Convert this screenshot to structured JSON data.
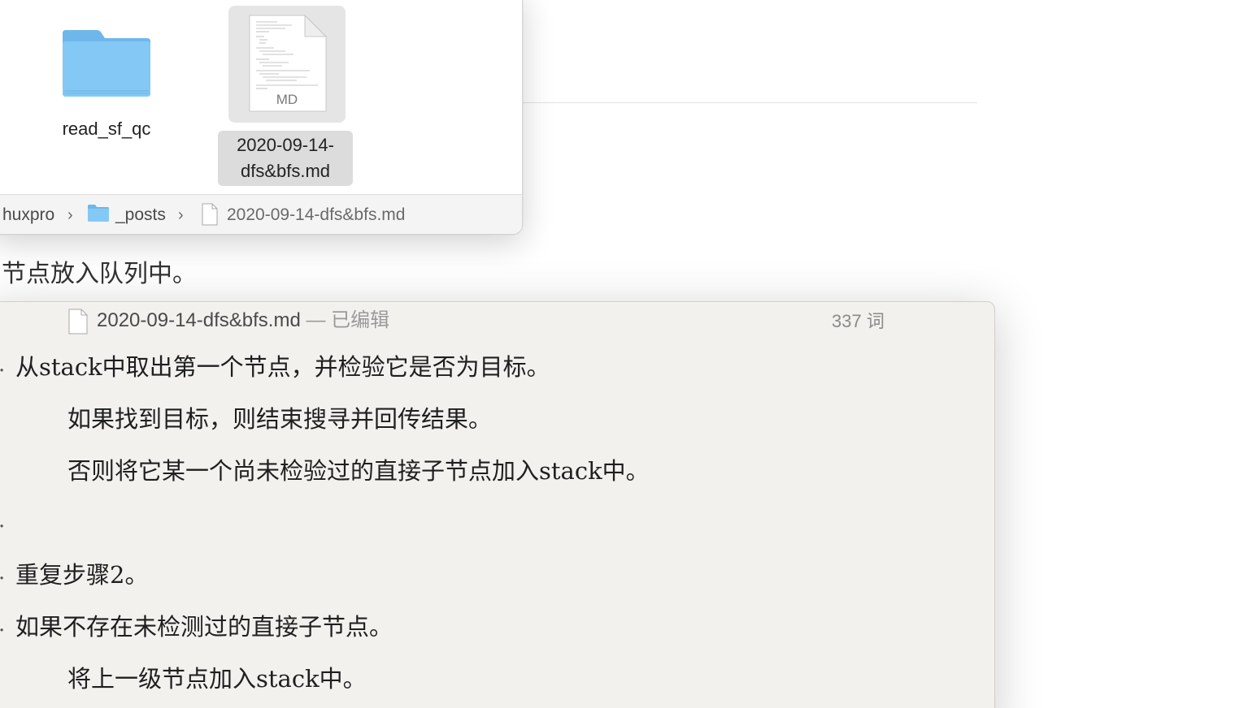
{
  "background_doc": {
    "text": "节点放入队列中。"
  },
  "finder": {
    "items": [
      {
        "name": "read_sf_qc",
        "kind": "folder"
      },
      {
        "name": "2020-09-14-dfs&bfs.md",
        "label_line1": "2020-09-14-",
        "label_line2": "dfs&bfs.md",
        "kind": "markdown",
        "badge": "MD",
        "selected": true
      }
    ],
    "path": [
      "huxpro",
      "_posts",
      "2020-09-14-dfs&bfs.md"
    ],
    "colors": {
      "folder": "#7cc3f2",
      "selection": "#dcdcdc"
    }
  },
  "editor": {
    "filename": "2020-09-14-dfs&bfs.md",
    "status": " — 已编辑",
    "word_count": "337 词",
    "lines": [
      "从stack中取出第一个节点，并检验它是否为目标。",
      "如果找到目标，则结束搜寻并回传结果。",
      "否则将它某一个尚未检验过的直接子节点加入stack中。",
      "重复步骤2。",
      "如果不存在未检测过的直接子节点。",
      "将上一级节点加入stack中。"
    ],
    "colors": {
      "background": "#f3f1ee"
    }
  }
}
